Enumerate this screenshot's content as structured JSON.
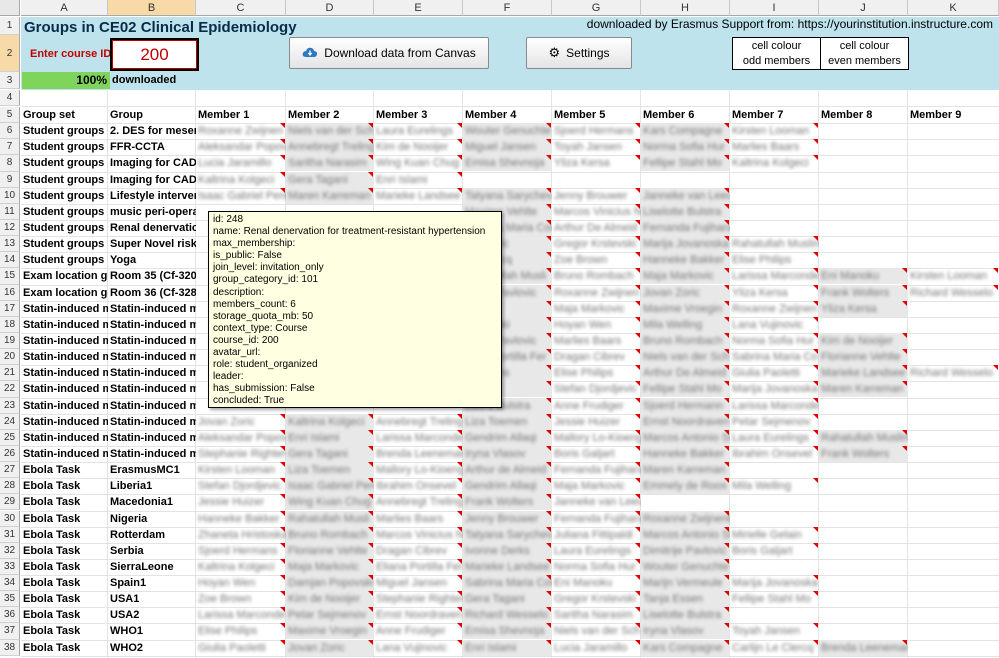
{
  "columns": [
    "A",
    "B",
    "C",
    "D",
    "E",
    "F",
    "G",
    "H",
    "I",
    "J",
    "K"
  ],
  "selected_column": "B",
  "selected_row": "2",
  "panel": {
    "title": "Groups in CE02 Clinical Epidemiology",
    "downloaded_by": "downloaded by Erasmus Support from: https://yourinstitution.instructure.com",
    "course_label": "Enter course ID:",
    "course_id": "200",
    "download_button": "Download data from Canvas",
    "settings_button": "Settings",
    "legend_odd_1": "cell colour",
    "legend_odd_2": "odd members",
    "legend_even_1": "cell colour",
    "legend_even_2": "even members",
    "progress": "100%",
    "progress_label": "downloaded"
  },
  "headers": [
    "Group set",
    "Group",
    "Member 1",
    "Member 2",
    "Member 3",
    "Member 4",
    "Member 5",
    "Member 6",
    "Member 7",
    "Member 8",
    "Member 9"
  ],
  "rows": [
    {
      "n": "6",
      "set": "Student groups",
      "group": "2. DES for mesent",
      "members": [
        "Roxanne Zwijnen",
        "Niels van der Sch",
        "Laura Eurelings",
        "Wouter Genuchte",
        "Sjoerd Hermans",
        "Kars Compagne",
        "Kirsten Looman"
      ]
    },
    {
      "n": "7",
      "set": "Student groups",
      "group": "FFR-CCTA",
      "members": [
        "Aleksandar Popov",
        "Annebregt Treling",
        "Kim de Nooijer",
        "Miguel Jansen",
        "Toyah Jansen",
        "Norma Sofia Hur",
        "Marlies Baars"
      ]
    },
    {
      "n": "8",
      "set": "Student groups",
      "group": "Imaging for CAD",
      "members": [
        "Lucia Jaramillo",
        "Saritha Narasim",
        "Wing Kuan Chug",
        "Emisa Shevnoja",
        "Yliza Kersa",
        "Fellipe Stahl Mo",
        "Kaltrina Kolgeci"
      ]
    },
    {
      "n": "9",
      "set": "Student groups",
      "group": "Imaging for CAD",
      "members": [
        "Kaltrina Kolgeci",
        "Gera Tagani",
        "Enri Islami"
      ]
    },
    {
      "n": "10",
      "set": "Student groups",
      "group": "Lifestyle interven",
      "members": [
        "Isaac Gabriel Pere",
        "Maren Karreman",
        "Marieke Landsee",
        "Tatyana Sarychev",
        "Jenny Brouwer",
        "Janneke van Leeuwen"
      ]
    },
    {
      "n": "11",
      "set": "Student groups",
      "group": "music peri-operat",
      "members": [
        "",
        "",
        "",
        "Maxime Vehlte",
        "Marcos Vinicius N",
        "Liselotte Bulstra"
      ]
    },
    {
      "n": "12",
      "set": "Student groups",
      "group": "Renal denervatio",
      "members": [
        "",
        "",
        "",
        "Sabrina Maria Cor",
        "Arthur De Almeid",
        "Fernanda Fujihara"
      ]
    },
    {
      "n": "13",
      "set": "Student groups",
      "group": "Super Novel risk i",
      "members": [
        "",
        "",
        "",
        "Markovic",
        "Gregor Krstevski",
        "Marija Jovanoska",
        "Rahatullah Muslim"
      ]
    },
    {
      "n": "14",
      "set": "Student groups",
      "group": "Yoga",
      "members": [
        "",
        "",
        "",
        "Le Clercq",
        "Zoe Brown",
        "Hanneke Bakker",
        "Elise Philips"
      ]
    },
    {
      "n": "15",
      "set": "Exam location gro",
      "group": "Room 35 (Cf-320)",
      "members": [
        "",
        "",
        "",
        "Rahatullah Musli",
        "Bruno Rombach",
        "Maja Markovic",
        "Larissa Marconde",
        "Eni Manoku",
        "Kirsten Looman"
      ]
    },
    {
      "n": "16",
      "set": "Exam location gro",
      "group": "Room 36 (Cf-328)",
      "members": [
        "",
        "",
        "",
        "Jorge Pavlovic",
        "Roxanne Zwijnen",
        "Jovan Zoric",
        "Yliza Kersa",
        "Frank Wolters",
        "Richard Wesselo"
      ]
    },
    {
      "n": "17",
      "set": "Statin-induced m",
      "group": "Statin-induced m",
      "members": [
        "",
        "",
        "",
        "Derks",
        "Maja Markovic",
        "Maxime Vroegin",
        "Roxanne Zwijnen",
        "Yliza Kersa"
      ]
    },
    {
      "n": "18",
      "set": "Statin-induced m",
      "group": "Statin-induced m",
      "members": [
        "",
        "",
        "",
        "Krstevski",
        "Hoyan Wen",
        "Mila Welling",
        "Lana Vujinovic"
      ]
    },
    {
      "n": "19",
      "set": "Statin-induced m",
      "group": "Statin-induced m",
      "members": [
        "",
        "",
        "",
        "Jorge Pavlovic",
        "Marlies Baars",
        "Bruno Rombach",
        "Norma Sofia Hur",
        "Kim de Nooijer"
      ]
    },
    {
      "n": "20",
      "set": "Statin-induced m",
      "group": "Statin-induced m",
      "members": [
        "",
        "",
        "",
        "Sofia Portilla Fer",
        "Dragan Cibrev",
        "Niels van der Sch",
        "Sabrina Maria Co",
        "Florianne Vehlte"
      ]
    },
    {
      "n": "21",
      "set": "Statin-induced m",
      "group": "Statin-induced m",
      "members": [
        "",
        "",
        "",
        "Hermans",
        "Elise Philips",
        "Arthur De Almeid",
        "Giulia Paoletti",
        "Marieke Landsee",
        "Richard Wesselo"
      ]
    },
    {
      "n": "22",
      "set": "Statin-induced m",
      "group": "Statin-induced m",
      "members": [
        "",
        "",
        "",
        "Brown",
        "Stefan Djordjevic",
        "Fellipe Stahl Mo",
        "Marija Jovanoska",
        "Maren Karreman"
      ]
    },
    {
      "n": "23",
      "set": "Statin-induced m",
      "group": "Statin-induced m",
      "members": [
        "",
        "",
        "",
        "Laura Bulstra",
        "Anne Frudiger",
        "Sjoerd Hermann",
        "Larissa Marconde"
      ]
    },
    {
      "n": "24",
      "set": "Statin-induced m",
      "group": "Statin-induced m",
      "members": [
        "Jovan Zoric",
        "Kaltrina Kolgeci",
        "Annebregt Treling",
        "Liza Toemen",
        "Jessie Huizer",
        "Ernst Noordraven",
        "Petar Sejmenov"
      ]
    },
    {
      "n": "25",
      "set": "Statin-induced m",
      "group": "Statin-induced m",
      "members": [
        "Aleksandar Popov",
        "Enri Islami",
        "Larissa Marconde",
        "Gendrim Allaqi",
        "Mallory Lo-Kioeng",
        "Marcos Antonio Sil",
        "Laura Eurelings",
        "Rahatullah Muslim"
      ]
    },
    {
      "n": "26",
      "set": "Statin-induced m",
      "group": "Statin-induced m",
      "members": [
        "Stephanie Righter",
        "Gera Tagani",
        "Brenda Leeneman",
        "Iryna Vlasov",
        "Boris Galjart",
        "Hanneke Bakker",
        "Ibrahim Onsevel",
        "Frank Wolters"
      ]
    },
    {
      "n": "27",
      "set": "Ebola Task",
      "group": "ErasmusMC1",
      "members": [
        "Kirsten Looman",
        "Liza Toemen",
        "Mallory Lo-Kioeng",
        "Arthur de Almeid",
        "Fernanda Fujihara",
        "Maren Karreman"
      ]
    },
    {
      "n": "28",
      "set": "Ebola Task",
      "group": "Liberia1",
      "members": [
        "Stefan Djordjevic",
        "Isaac Gabriel Pere",
        "Ibrahim Onsevel",
        "Gendrim Allaqi",
        "Maja Markovic",
        "Emmely de Roos",
        "Mila Welling"
      ]
    },
    {
      "n": "29",
      "set": "Ebola Task",
      "group": "Macedonia1",
      "members": [
        "Jessie Huizer",
        "Wing Kuan Chug",
        "Annebregt Treling",
        "Frank Wolters",
        "Janneke van Leeuwen"
      ]
    },
    {
      "n": "30",
      "set": "Ebola Task",
      "group": "Nigeria",
      "members": [
        "Hanneke Bakker",
        "Rahatullah Musli",
        "Marlies Baars",
        "Jenny Brouwer",
        "Fernanda Fujihara",
        "Roxanne Zwijnenberg"
      ]
    },
    {
      "n": "31",
      "set": "Ebola Task",
      "group": "Rotterdam",
      "members": [
        "Zhaneta Hristoska",
        "Bruno Rombach",
        "Marcos Vinicius N",
        "Tatyana Sarychev",
        "Juliana Fittipaldi",
        "Marcos Antonio Sil",
        "Mirielle Gelain"
      ]
    },
    {
      "n": "32",
      "set": "Ebola Task",
      "group": "Serbia",
      "members": [
        "Sjoerd Hermans",
        "Florianne Vehlte",
        "Dragan Cibrev",
        "Ivonne Derks",
        "Laura Eurelings",
        "Dimitrije Pavlovic",
        "Boris Galjart"
      ]
    },
    {
      "n": "33",
      "set": "Ebola Task",
      "group": "SierraLeone",
      "members": [
        "Kaltrina Kolgeci",
        "Maja Markovic",
        "Eliana Portilla Fer",
        "Marieke Landsee",
        "Norma Sofia Hur",
        "Wouter Genuchte"
      ]
    },
    {
      "n": "34",
      "set": "Ebola Task",
      "group": "Spain1",
      "members": [
        "Hoyan Wen",
        "Damjan Popovski",
        "Miguel Jansen",
        "Sabrina Maria Cor",
        "Eni Manoku",
        "Marijn Vermeule",
        "Marija Jovanoska"
      ]
    },
    {
      "n": "35",
      "set": "Ebola Task",
      "group": "USA1",
      "members": [
        "Zoe Brown",
        "Kim de Nooijer",
        "Stephanie Righter",
        "Gera Tagani",
        "Gregor Krstevski",
        "Tanja Essen",
        "Fellipe Stahl Mo"
      ]
    },
    {
      "n": "36",
      "set": "Ebola Task",
      "group": "USA2",
      "members": [
        "Larissa Marconde",
        "Petar Sejmenov",
        "Ernst Noordraven",
        "Richard Wesselo",
        "Saritha Narasim",
        "Liselotte Bulstra"
      ]
    },
    {
      "n": "37",
      "set": "Ebola Task",
      "group": "WHO1",
      "members": [
        "Elise Philips",
        "Maxime Vroegin",
        "Anne Frudiger",
        "Emisa Shevnoja",
        "Niels van der Sch",
        "Iryna Vlasov",
        "Toyah Jansen"
      ]
    },
    {
      "n": "38",
      "set": "Ebola Task",
      "group": "WHO2",
      "members": [
        "Giulia Paoletti",
        "Jovan Zoric",
        "Lana Vujinovic",
        "Enri Islami",
        "Lucia Jaramillo",
        "Kars Compagne",
        "Carlijn Le Clercq",
        "Brenda Leeneman"
      ]
    }
  ],
  "tooltip": [
    "id: 248",
    "name: Renal denervation for treatment-resistant hypertension",
    "max_membership:",
    "is_public: False",
    "join_level: invitation_only",
    "group_category_id: 101",
    "description:",
    "members_count: 6",
    "storage_quota_mb: 50",
    "context_type: Course",
    "course_id: 200",
    "avatar_url:",
    "role: student_organized",
    "leader:",
    "has_submission: False",
    "concluded: True"
  ],
  "colors": {
    "panel": "#bfe3ed",
    "title": "#0b2a4a",
    "accent_red": "#c00000",
    "progress": "#7fd45c",
    "tooltip": "#ffffe1"
  },
  "icons": {
    "download": "cloud-download-icon",
    "settings": "gear-icon"
  }
}
